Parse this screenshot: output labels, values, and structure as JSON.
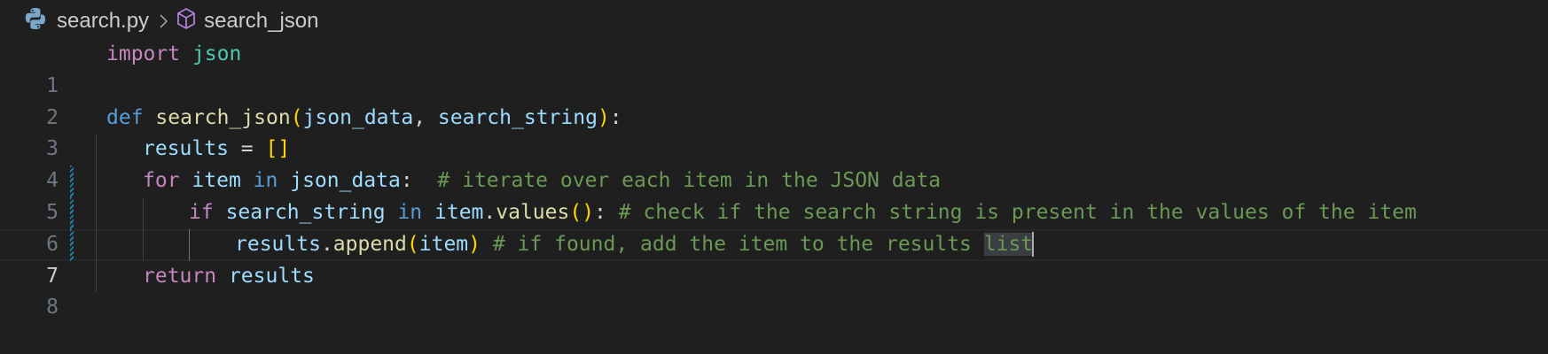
{
  "breadcrumb": {
    "file": "search.py",
    "symbol": "search_json",
    "file_icon": "python-icon",
    "symbol_icon": "symbol-method-icon"
  },
  "lines": {
    "n1": "1",
    "n2": "2",
    "n3": "3",
    "n4": "4",
    "n5": "5",
    "n6": "6",
    "n7": "7",
    "n8": "8"
  },
  "code": {
    "l1": {
      "kw": "import",
      "sp": " ",
      "mod": "json"
    },
    "l3": {
      "kw": "def",
      "sp1": " ",
      "fn": "search_json",
      "open": "(",
      "p1": "json_data",
      "comma": ", ",
      "p2": "search_string",
      "close": ")",
      "colon": ":"
    },
    "l4": {
      "var": "results",
      "eq": " = ",
      "list": "[]"
    },
    "l5": {
      "kw": "for",
      "sp1": " ",
      "var1": "item",
      "sp2": " ",
      "kw2": "in",
      "sp3": " ",
      "var2": "json_data",
      "colon": ":",
      "gap": "  ",
      "comment": "# iterate over each item in the JSON data"
    },
    "l6": {
      "kw": "if",
      "sp1": " ",
      "var1": "search_string",
      "sp2": " ",
      "kw2": "in",
      "sp3": " ",
      "var2": "item",
      "dot": ".",
      "fn": "values",
      "parens": "()",
      "colon": ":",
      "gap": " ",
      "comment": "# check if the search string is present in the values of the item"
    },
    "l7": {
      "var1": "results",
      "dot": ".",
      "fn": "append",
      "open": "(",
      "arg": "item",
      "close": ")",
      "gap": " ",
      "comment": "# if found, add the item to the results ",
      "comment_hl": "list"
    },
    "l8": {
      "kw": "return",
      "sp": " ",
      "var": "results"
    }
  },
  "colors": {
    "background": "#1f1f1f",
    "keyword": "#569cd6",
    "control_keyword": "#c586c0",
    "function": "#dcdcaa",
    "variable": "#9cdcfe",
    "comment": "#6a9955",
    "module": "#4ec9b0",
    "modified_gutter": "#1b81a8"
  }
}
